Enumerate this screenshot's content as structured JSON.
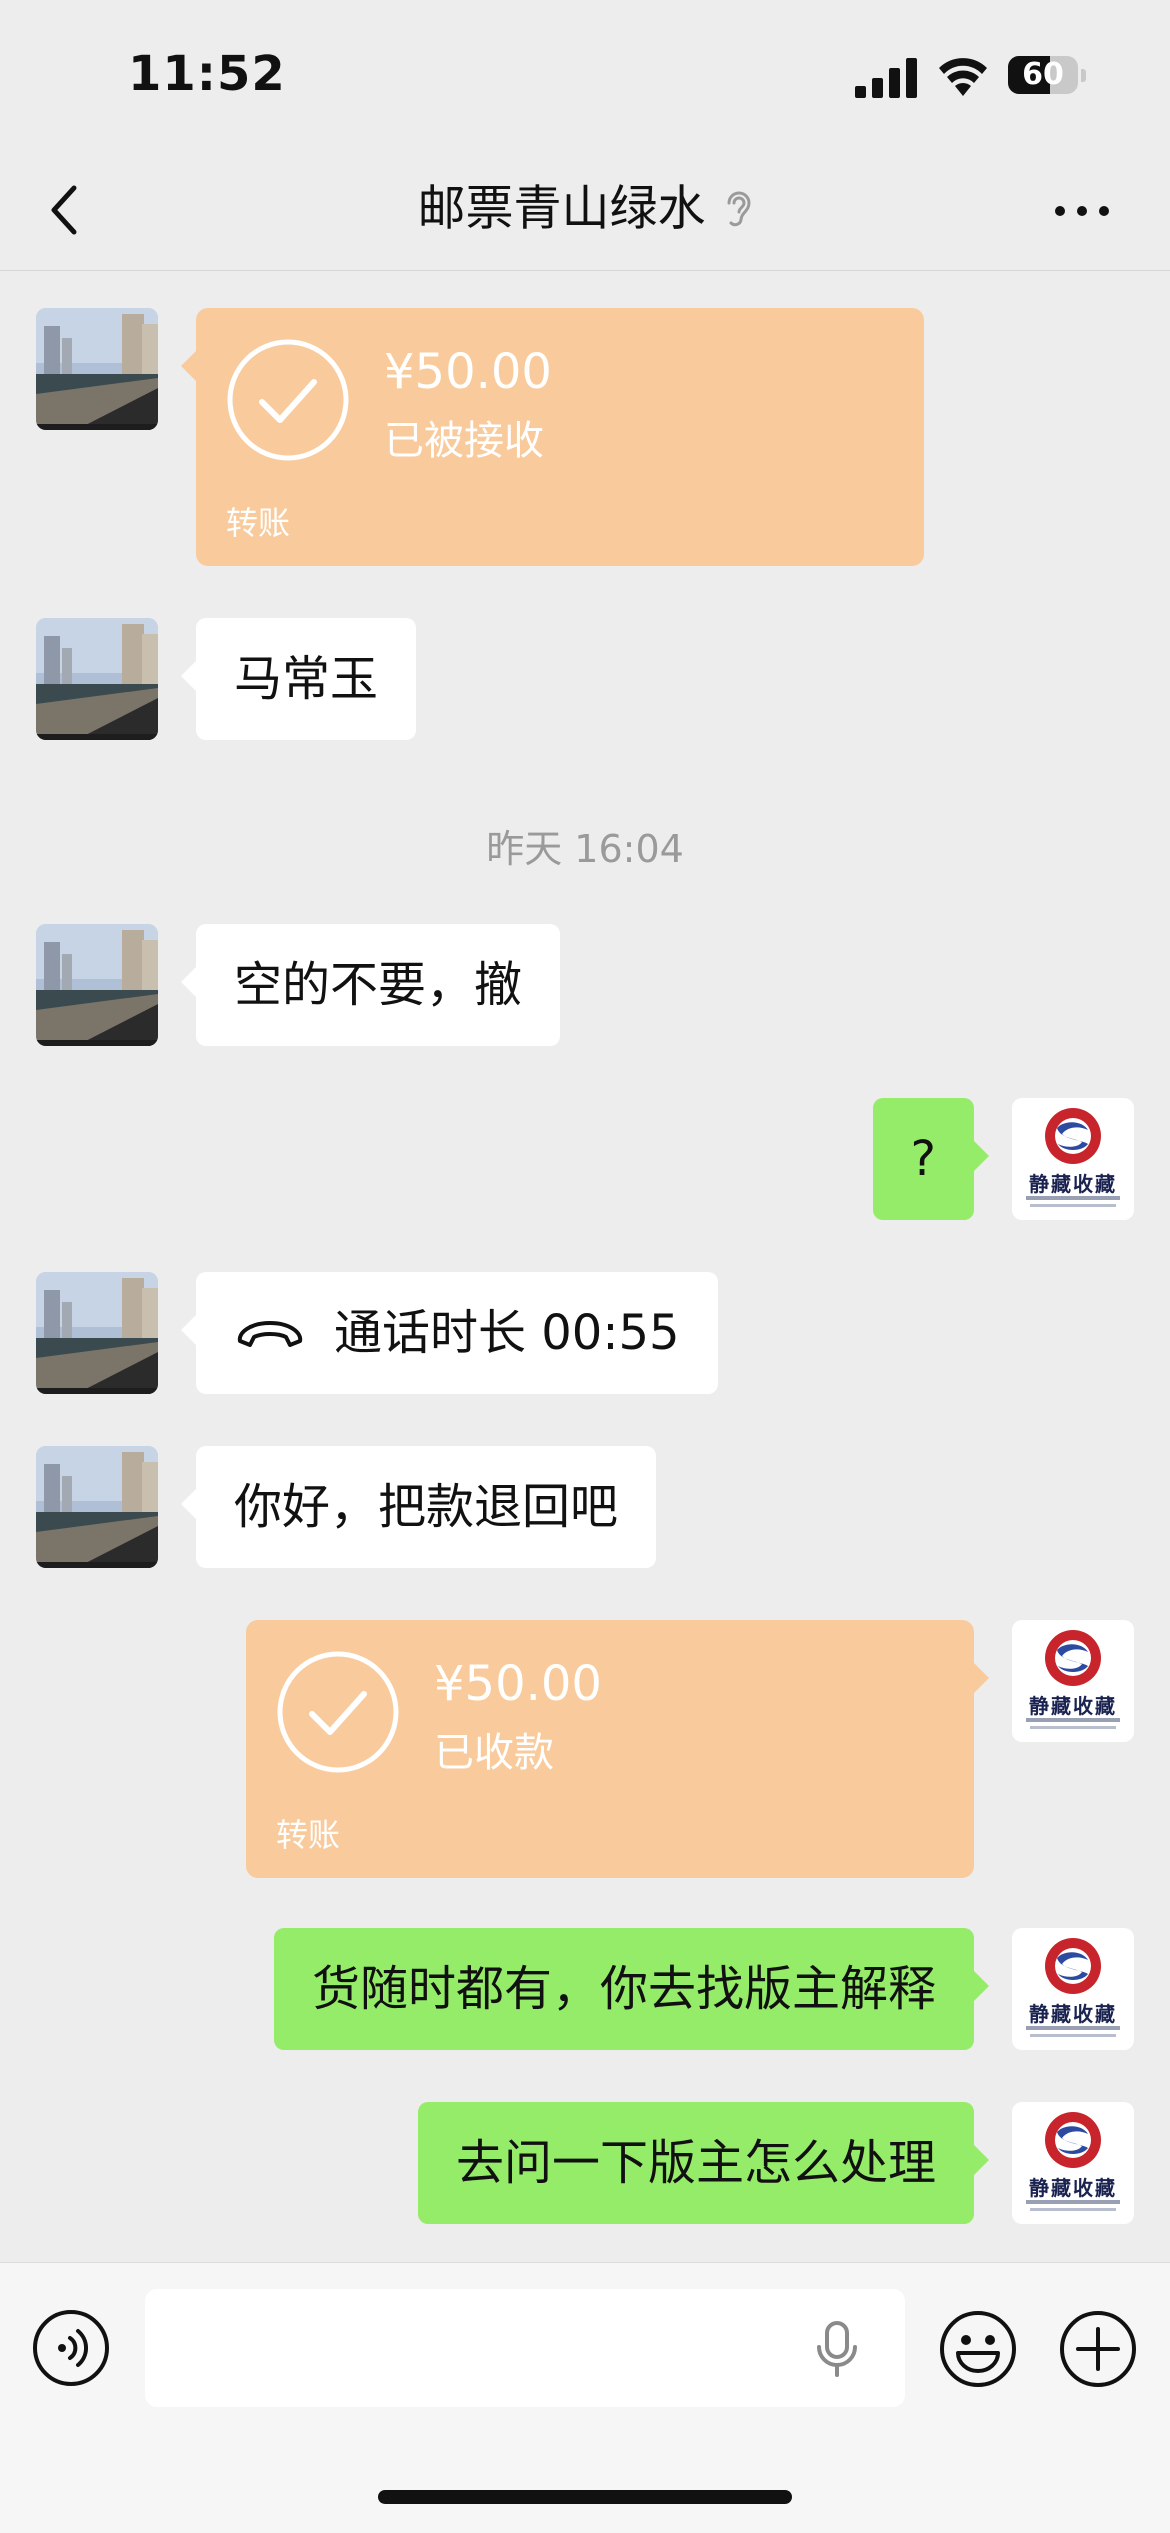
{
  "status_bar": {
    "time": "11:52",
    "battery": "60",
    "battery_fraction": 0.6
  },
  "header": {
    "title": "邮票青山绿水",
    "back_icon": "chevron-left-icon",
    "earpiece_icon": "ear-icon",
    "more_icon": "ellipsis-icon"
  },
  "messages": [
    {
      "side": "left",
      "type": "transfer",
      "amount": "¥50.00",
      "status": "已被接收",
      "label": "转账"
    },
    {
      "side": "left",
      "type": "text",
      "text": "马常玉"
    },
    {
      "type": "time",
      "text": "昨天 16:04"
    },
    {
      "side": "left",
      "type": "text",
      "text": "空的不要，撤"
    },
    {
      "side": "right",
      "type": "text",
      "text": "?"
    },
    {
      "side": "left",
      "type": "call",
      "text": "通话时长 00:55"
    },
    {
      "side": "left",
      "type": "text",
      "text": "你好，把款退回吧"
    },
    {
      "side": "right",
      "type": "transfer",
      "amount": "¥50.00",
      "status": "已收款",
      "label": "转账"
    },
    {
      "side": "right",
      "type": "text",
      "text": "货随时都有，你去找版主解释"
    },
    {
      "side": "right",
      "type": "text",
      "text": "去问一下版主怎么处理"
    }
  ],
  "self_avatar": {
    "logo_text": "静藏收藏"
  },
  "input_bar": {
    "placeholder": "",
    "voice_icon": "voice-toggle-icon",
    "mic_icon": "microphone-icon",
    "emoji_icon": "emoji-icon",
    "plus_icon": "plus-icon"
  },
  "colors": {
    "background": "#ededed",
    "self_bubble": "#95ec69",
    "other_bubble": "#ffffff",
    "transfer_card": "#f9cb9c",
    "timestamp": "#9a9a9a"
  }
}
